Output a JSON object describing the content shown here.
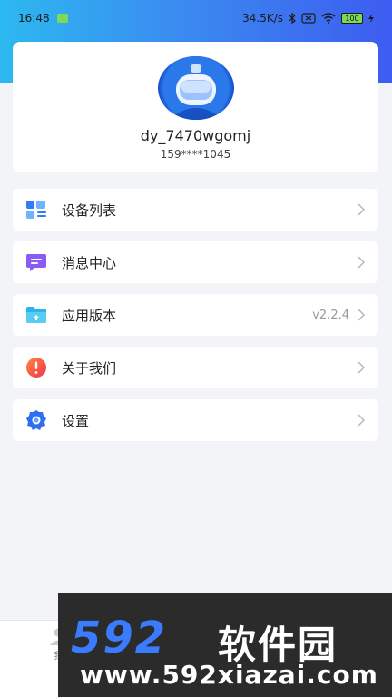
{
  "status_bar": {
    "time": "16:48",
    "net_speed": "34.5K/s",
    "battery": "100"
  },
  "profile": {
    "username": "dy_7470wgomj",
    "phone": "159****1045"
  },
  "menu": {
    "items": [
      {
        "label": "设备列表",
        "value": "",
        "icon": "device-list-icon"
      },
      {
        "label": "消息中心",
        "value": "",
        "icon": "message-icon"
      },
      {
        "label": "应用版本",
        "value": "v2.2.4",
        "icon": "folder-icon"
      },
      {
        "label": "关于我们",
        "value": "",
        "icon": "info-icon"
      },
      {
        "label": "设置",
        "value": "",
        "icon": "gear-icon"
      }
    ]
  },
  "bottom_nav": {
    "label": "我"
  },
  "watermark": {
    "brand_number": "592",
    "brand_text": "软件园",
    "url": "www.592xiazai.com"
  },
  "colors": {
    "header_gradient_start": "#2db8f0",
    "header_gradient_end": "#3d5cf0",
    "background": "#f3f4f8",
    "chevron": "#b8b8b8"
  }
}
